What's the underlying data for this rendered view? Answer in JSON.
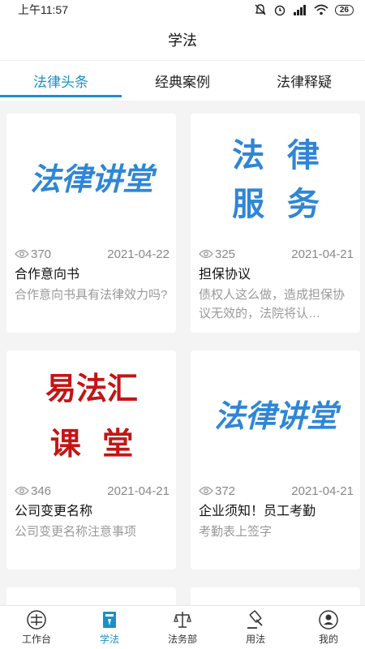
{
  "status_bar": {
    "time": "上午11:57",
    "battery": "26"
  },
  "header": {
    "title": "学法"
  },
  "tabs": [
    {
      "label": "法律头条",
      "active": true
    },
    {
      "label": "经典案例",
      "active": false
    },
    {
      "label": "法律释疑",
      "active": false
    }
  ],
  "cards": [
    {
      "image_text": [
        "法律讲堂"
      ],
      "image_color": "#2f86d6",
      "views": "370",
      "date": "2021-04-22",
      "title": "合作意向书",
      "desc": "合作意向书具有法律效力吗?"
    },
    {
      "image_text": [
        "法  律",
        "服  务"
      ],
      "image_color": "#2f86d6",
      "views": "325",
      "date": "2021-04-21",
      "title": "担保协议",
      "desc": "债权人这么做，造成担保协议无效的，法院将认…"
    },
    {
      "image_text": [
        "易法汇",
        "课  堂"
      ],
      "image_color": "#c41515",
      "views": "346",
      "date": "2021-04-21",
      "title": "公司变更名称",
      "desc": "公司变更名称注意事项"
    },
    {
      "image_text": [
        "法律讲堂"
      ],
      "image_color": "#2f86d6",
      "views": "372",
      "date": "2021-04-21",
      "title": "企业须知！员工考勤",
      "desc": "考勤表上签字"
    }
  ],
  "bottom_nav": [
    {
      "label": "工作台",
      "icon": "workbench-icon",
      "active": false
    },
    {
      "label": "学法",
      "icon": "book-icon",
      "active": true
    },
    {
      "label": "法务部",
      "icon": "scales-icon",
      "active": false
    },
    {
      "label": "用法",
      "icon": "gavel-icon",
      "active": false
    },
    {
      "label": "我的",
      "icon": "user-icon",
      "active": false
    }
  ],
  "colors": {
    "accent": "#1e8fc6",
    "blue_title": "#2f86d6",
    "red_title": "#c41515"
  }
}
